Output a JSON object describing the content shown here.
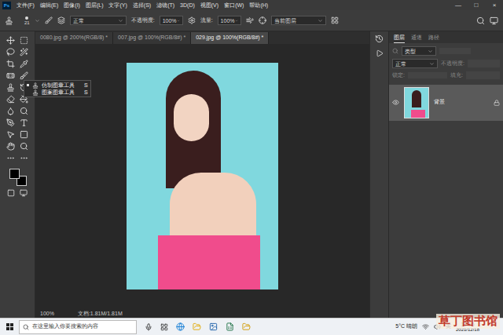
{
  "app": {
    "logo": "Ps"
  },
  "menu": [
    "文件(F)",
    "编辑(E)",
    "图像(I)",
    "图层(L)",
    "文字(Y)",
    "选择(S)",
    "滤镜(T)",
    "3D(D)",
    "视图(V)",
    "窗口(W)",
    "帮助(H)"
  ],
  "window_controls": [
    "—",
    "□",
    "×"
  ],
  "options_bar": {
    "brush_size": "21",
    "mode": "正常",
    "opacity_label": "不透明度:",
    "opacity": "100%",
    "flow_label": "流量:",
    "flow": "100%",
    "sample": "当前图层"
  },
  "tabs": [
    {
      "label": "0080.jpg @ 200%(RGB/8) *",
      "selected": false
    },
    {
      "label": "007.jpg @ 100%(RGB/8#) *",
      "selected": false
    },
    {
      "label": "029.jpg @ 100%(RGB/8#) *",
      "selected": true
    }
  ],
  "tool_flyout": [
    {
      "label": "仿制图章工具",
      "shortcut": "S",
      "selected": true
    },
    {
      "label": "图案图章工具",
      "shortcut": "S",
      "selected": false
    }
  ],
  "status_bar": {
    "zoom": "100%",
    "doc": "文档:1.81M/1.81M"
  },
  "layers_panel": {
    "tabs": [
      {
        "label": "图层",
        "selected": true
      },
      {
        "label": "通道",
        "selected": false
      },
      {
        "label": "路径",
        "selected": false
      }
    ],
    "filter": "类型",
    "blend": "正常",
    "opacity_label": "不透明度:",
    "lock_label": "锁定:",
    "fill_label": "填充:",
    "layers": [
      {
        "name": "背景",
        "visible": true,
        "locked": true,
        "selected": true
      }
    ]
  },
  "taskbar": {
    "search": "在这里输入你要搜索的内容",
    "weather": "5°C 晴朗",
    "ime": "英",
    "time": "16:25",
    "date": "2021/12/18"
  },
  "watermark": "草丁图书馆"
}
